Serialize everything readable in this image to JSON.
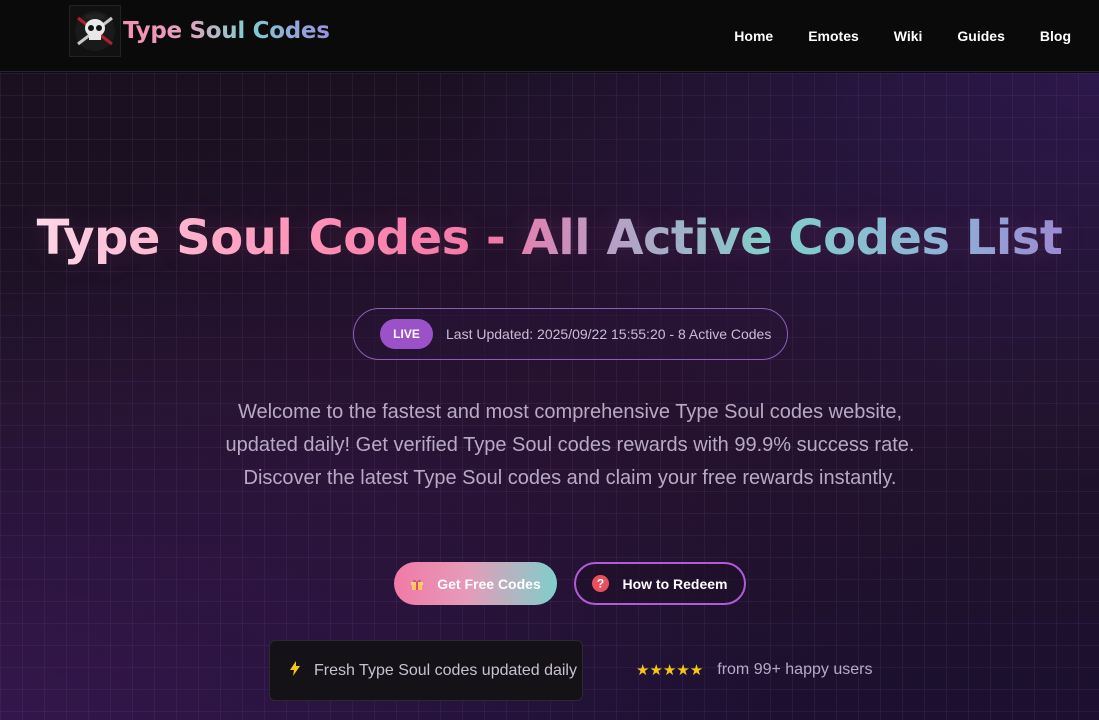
{
  "header": {
    "logo_text": "Type Soul Codes",
    "nav": [
      {
        "label": "Home"
      },
      {
        "label": "Emotes"
      },
      {
        "label": "Wiki"
      },
      {
        "label": "Guides"
      },
      {
        "label": "Blog"
      }
    ]
  },
  "hero": {
    "title": "Type Soul Codes - All Active Codes List",
    "live_badge": "LIVE",
    "status_text": "Last Updated: 2025/09/22 15:55:20 - 8 Active Codes",
    "description": "Welcome to the fastest and most comprehensive Type Soul codes website, updated daily! Get verified Type Soul codes rewards with 99.9% success rate. Discover the latest Type Soul codes and claim your free rewards instantly.",
    "primary_button": "Get Free Codes",
    "secondary_button": "How to Redeem",
    "fresh_text": "Fresh Type Soul codes updated daily",
    "stars": "★★★★★",
    "rating_text": "from 99+ happy users"
  },
  "icons": {
    "primary_button_icon": "gift-icon",
    "secondary_button_icon": "question-circle-icon",
    "fresh_icon": "lightning-icon",
    "logo_icon": "skull-crossbones-icon"
  },
  "colors": {
    "accent_pink": "#f07aa8",
    "accent_teal": "#7fcfcb",
    "accent_purple": "#9b52c8",
    "star_yellow": "#f5c518"
  }
}
